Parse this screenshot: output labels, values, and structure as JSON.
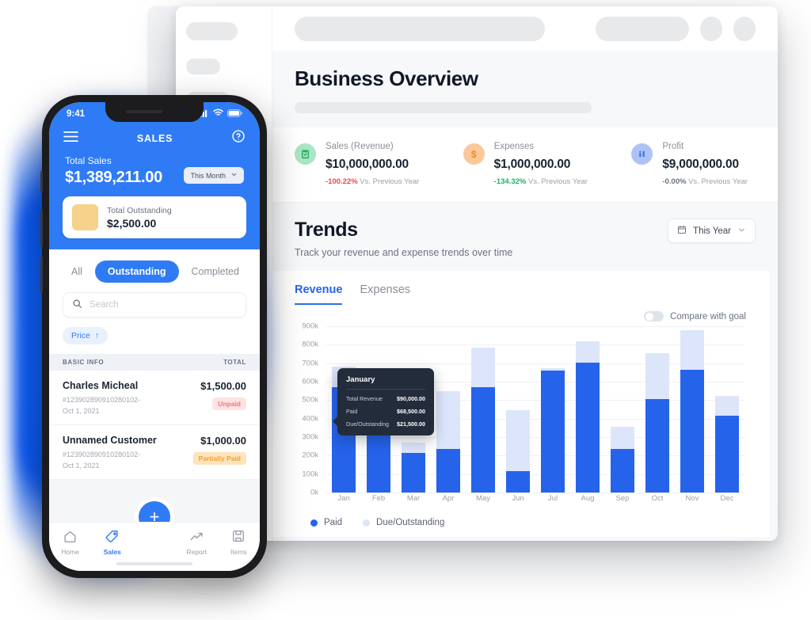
{
  "desktop": {
    "topbar": {
      "search_skeleton": "",
      "pill_skeleton": "",
      "circles": 2
    },
    "page_title": "Business Overview",
    "stats": [
      {
        "icon": "clipboard-check-icon",
        "label": "Sales (Revenue)",
        "value": "$10,000,000.00",
        "delta": "-100.22%",
        "delta_suffix": " Vs. Previous Year",
        "delta_color": "#ef4444",
        "icon_bg": "#a8e6c4",
        "icon_fg": "#12a150"
      },
      {
        "icon": "dollar-circle-icon",
        "label": "Expenses",
        "value": "$1,000,000.00",
        "delta": "-134.32%",
        "delta_suffix": " Vs. Previous Year",
        "delta_color": "#18b368",
        "icon_bg": "#fcc89a",
        "icon_fg": "#f08a24"
      },
      {
        "icon": "bar-chart-icon",
        "label": "Profit",
        "value": "$9,000,000.00",
        "delta": "-0.00%",
        "delta_suffix": " Vs. Previous Year",
        "delta_color": "#6b7280",
        "icon_bg": "#aec3f5",
        "icon_fg": "#3b6fe0"
      }
    ],
    "trends": {
      "title": "Trends",
      "subtitle": "Track your revenue and expense trends over time",
      "range_label": "This Year",
      "tabs": [
        {
          "label": "Revenue",
          "active": true
        },
        {
          "label": "Expenses",
          "active": false
        }
      ],
      "toggle_label": "Compare with goal",
      "toggle_on": false
    }
  },
  "chart_data": {
    "type": "bar",
    "stacked": true,
    "title": "Trends",
    "xlabel": "",
    "ylabel": "",
    "ylim": [
      0,
      900000
    ],
    "grid": true,
    "legend_position": "bottom-left",
    "y_ticks": [
      "0k",
      "100k",
      "200k",
      "300k",
      "400k",
      "500k",
      "600k",
      "700k",
      "800k",
      "900k"
    ],
    "categories": [
      "Jan",
      "Feb",
      "Mar",
      "Apr",
      "May",
      "Jun",
      "Jul",
      "Aug",
      "Sep",
      "Oct",
      "Nov",
      "Dec"
    ],
    "series": [
      {
        "name": "Paid",
        "color": "#2563eb",
        "values": [
          570000,
          570000,
          215000,
          235000,
          570000,
          115000,
          660000,
          705000,
          235000,
          505000,
          665000,
          415000
        ]
      },
      {
        "name": "Due/Outstanding",
        "color": "#dde5fa",
        "values": [
          110000,
          0,
          55000,
          315000,
          215000,
          330000,
          15000,
          115000,
          120000,
          250000,
          215000,
          110000
        ]
      }
    ],
    "tooltip": {
      "month": "January",
      "rows": [
        {
          "label": "Total Revenue",
          "value": "$90,000.00"
        },
        {
          "label": "Paid",
          "value": "$68,500.00"
        },
        {
          "label": "Due/Outstanding",
          "value": "$21,500.00"
        }
      ]
    }
  },
  "phone": {
    "status": {
      "time": "9:41",
      "signal_icon": "cellular-icon",
      "wifi_icon": "wifi-icon",
      "battery_icon": "battery-icon"
    },
    "nav": {
      "menu_icon": "hamburger-menu-icon",
      "title": "SALES",
      "help_icon": "help-circle-icon"
    },
    "total": {
      "label": "Total Sales",
      "value": "$1,389,211.00",
      "range_label": "This Month"
    },
    "outstanding": {
      "label": "Total Outstanding",
      "value": "$2,500.00",
      "swatch_color": "#f6d28a"
    },
    "segments": [
      {
        "label": "All",
        "active": false
      },
      {
        "label": "Outstanding",
        "active": true
      },
      {
        "label": "Completed",
        "active": false
      }
    ],
    "search_placeholder": "Search",
    "sort_chip": {
      "label": "Price",
      "arrow": "↑"
    },
    "columns": {
      "left": "BASIC INFO",
      "right": "TOTAL"
    },
    "rows": [
      {
        "name": "Charles Micheal",
        "ref": "#123902890910280102-",
        "date": "Oct 1, 2021",
        "amount": "$1,500.00",
        "badge": "Unpaid",
        "badge_type": "unpaid"
      },
      {
        "name": "Unnamed Customer",
        "ref": "#123902890910280102-",
        "date": "Oct 1, 2021",
        "amount": "$1,000.00",
        "badge": "Partially Paid",
        "badge_type": "partial"
      }
    ],
    "fab_label": "+",
    "tabbar": [
      {
        "label": "Home",
        "icon": "home-icon",
        "active": false
      },
      {
        "label": "Sales",
        "icon": "tag-icon",
        "active": true
      },
      {
        "label": "Report",
        "icon": "trending-up-icon",
        "active": false
      },
      {
        "label": "Items",
        "icon": "save-box-icon",
        "active": false
      }
    ]
  }
}
